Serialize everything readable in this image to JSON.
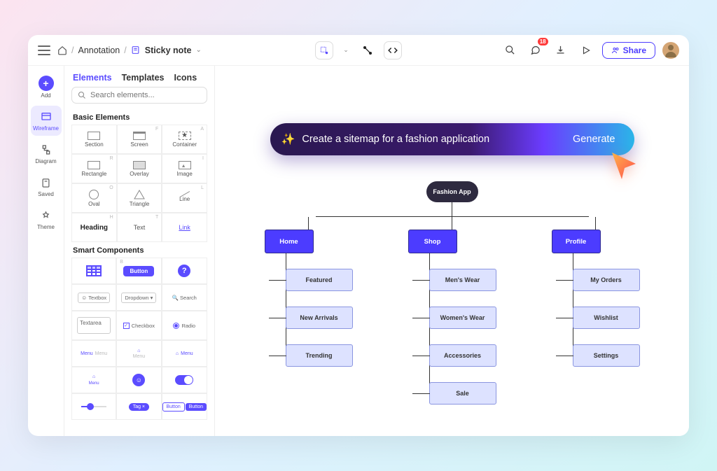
{
  "breadcrumb": {
    "item1": "Annotation",
    "current": "Sticky note"
  },
  "topbar": {
    "share_label": "Share",
    "notification_badge": "18"
  },
  "rail": {
    "add": "Add",
    "wireframe": "Wireframe",
    "diagram": "Diagram",
    "saved": "Saved",
    "theme": "Theme"
  },
  "panel": {
    "tabs": {
      "elements": "Elements",
      "templates": "Templates",
      "icons": "Icons"
    },
    "search_placeholder": "Search elements...",
    "section_basic": "Basic Elements",
    "section_smart": "Smart Components",
    "basic": {
      "section": "Section",
      "screen": "Screen",
      "container": "Container",
      "rectangle": "Rectangle",
      "overlay": "Overlay",
      "image": "Image",
      "oval": "Oval",
      "triangle": "Triangle",
      "line": "Line",
      "heading": "Heading",
      "text": "Text",
      "link": "Link"
    },
    "keys": {
      "f": "F",
      "a": "A",
      "r": "R",
      "i": "I",
      "o": "O",
      "l": "L",
      "h": "H",
      "t": "T",
      "b": "B"
    },
    "smart": {
      "button": "Button",
      "textbox": "Textbox",
      "dropdown": "Dropdown",
      "search": "Search",
      "textarea": "Textarea",
      "checkbox": "Checkbox",
      "radio": "Radio",
      "menu": "Menu",
      "tag": "Tag ×"
    }
  },
  "prompt": {
    "text": "Create a sitemap for a fashion application",
    "generate": "Generate"
  },
  "sitemap": {
    "root": "Fashion App",
    "home": {
      "label": "Home",
      "children": [
        "Featured",
        "New Arrivals",
        "Trending"
      ]
    },
    "shop": {
      "label": "Shop",
      "children": [
        "Men's Wear",
        "Women's Wear",
        "Accessories",
        "Sale"
      ]
    },
    "profile": {
      "label": "Profile",
      "children": [
        "My Orders",
        "Wishlist",
        "Settings"
      ]
    }
  }
}
